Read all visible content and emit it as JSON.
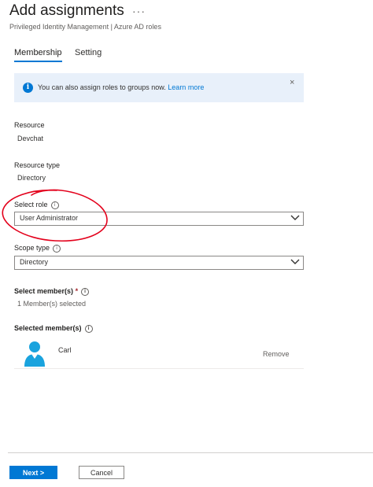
{
  "header": {
    "title": "Add assignments",
    "more_label": "···",
    "subtitle": "Privileged Identity Management | Azure AD roles"
  },
  "tabs": [
    {
      "label": "Membership",
      "active": true
    },
    {
      "label": "Setting",
      "active": false
    }
  ],
  "banner": {
    "icon": "info-icon",
    "text": "You can also assign roles to groups now.",
    "link": "Learn more",
    "close": "×"
  },
  "resource": {
    "label": "Resource",
    "value": "Devchat"
  },
  "resource_type": {
    "label": "Resource type",
    "value": "Directory"
  },
  "select_role": {
    "label": "Select role",
    "value": "User Administrator"
  },
  "scope_type": {
    "label": "Scope type",
    "value": "Directory"
  },
  "select_members": {
    "label": "Select member(s)",
    "required_mark": "*",
    "value": "1 Member(s) selected"
  },
  "selected_members": {
    "label": "Selected member(s)",
    "items": [
      {
        "name": "Carl",
        "remove_label": "Remove"
      }
    ]
  },
  "footer": {
    "next_label": "Next >",
    "cancel_label": "Cancel"
  },
  "colors": {
    "accent": "#0078d4",
    "banner_bg": "#e8f0fa",
    "annotation": "#e3001b"
  }
}
